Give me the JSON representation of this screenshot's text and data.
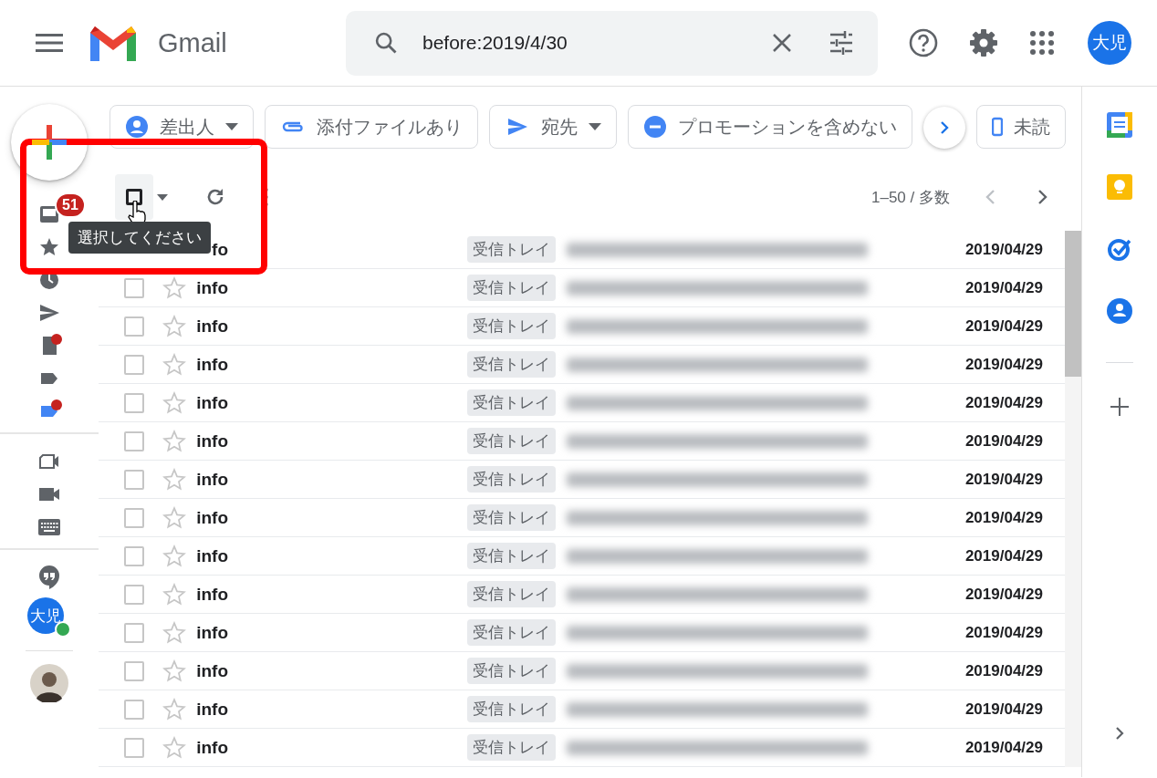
{
  "header": {
    "app_name": "Gmail",
    "search": {
      "value": "before:2019/4/30"
    },
    "account_initials": "大児"
  },
  "compose": {
    "unread_count": "51"
  },
  "rail": [
    {
      "kind": "star"
    },
    {
      "kind": "clock"
    },
    {
      "kind": "send"
    },
    {
      "kind": "draft",
      "dot": true
    },
    {
      "kind": "label",
      "dot": false
    },
    {
      "kind": "bluelabel",
      "dot": true
    },
    {
      "kind": "divider"
    },
    {
      "kind": "meet"
    },
    {
      "kind": "video"
    },
    {
      "kind": "keyboard"
    },
    {
      "kind": "divider"
    },
    {
      "kind": "hangouts"
    }
  ],
  "chat_user": {
    "initials": "大児",
    "online": true
  },
  "filter_chips": [
    {
      "kind": "person",
      "label": "差出人",
      "dropdown": true
    },
    {
      "kind": "attachment",
      "label": "添付ファイルあり",
      "dropdown": false
    },
    {
      "kind": "send",
      "label": "宛先",
      "dropdown": true
    },
    {
      "kind": "minus",
      "label": "プロモーションを含めない",
      "dropdown": false
    },
    {
      "kind": "unread",
      "label": "未読",
      "dropdown": false
    }
  ],
  "toolbar": {
    "select_all": {
      "checked": false
    },
    "pagination": "1–50 / 多数",
    "tooltip": "選択してください"
  },
  "emails": [
    {
      "sender": "fo",
      "label": "受信トレイ",
      "date": "2019/04/29"
    },
    {
      "sender": "info",
      "label": "受信トレイ",
      "date": "2019/04/29",
      "checked": false,
      "starred": false
    },
    {
      "sender": "info",
      "label": "受信トレイ",
      "date": "2019/04/29",
      "checked": false,
      "starred": false
    },
    {
      "sender": "info",
      "label": "受信トレイ",
      "date": "2019/04/29",
      "checked": false,
      "starred": false
    },
    {
      "sender": "info",
      "label": "受信トレイ",
      "date": "2019/04/29",
      "checked": false,
      "starred": false
    },
    {
      "sender": "info",
      "label": "受信トレイ",
      "date": "2019/04/29",
      "checked": false,
      "starred": false
    },
    {
      "sender": "info",
      "label": "受信トレイ",
      "date": "2019/04/29",
      "checked": false,
      "starred": false
    },
    {
      "sender": "info",
      "label": "受信トレイ",
      "date": "2019/04/29",
      "checked": false,
      "starred": false
    },
    {
      "sender": "info",
      "label": "受信トレイ",
      "date": "2019/04/29",
      "checked": false,
      "starred": false
    },
    {
      "sender": "info",
      "label": "受信トレイ",
      "date": "2019/04/29",
      "checked": false,
      "starred": false
    },
    {
      "sender": "info",
      "label": "受信トレイ",
      "date": "2019/04/29",
      "checked": false,
      "starred": false
    },
    {
      "sender": "info",
      "label": "受信トレイ",
      "date": "2019/04/29",
      "checked": false,
      "starred": false
    },
    {
      "sender": "info",
      "label": "受信トレイ",
      "date": "2019/04/29",
      "checked": false,
      "starred": false
    },
    {
      "sender": "info",
      "label": "受信トレイ",
      "date": "2019/04/29",
      "checked": false,
      "starred": false
    }
  ]
}
